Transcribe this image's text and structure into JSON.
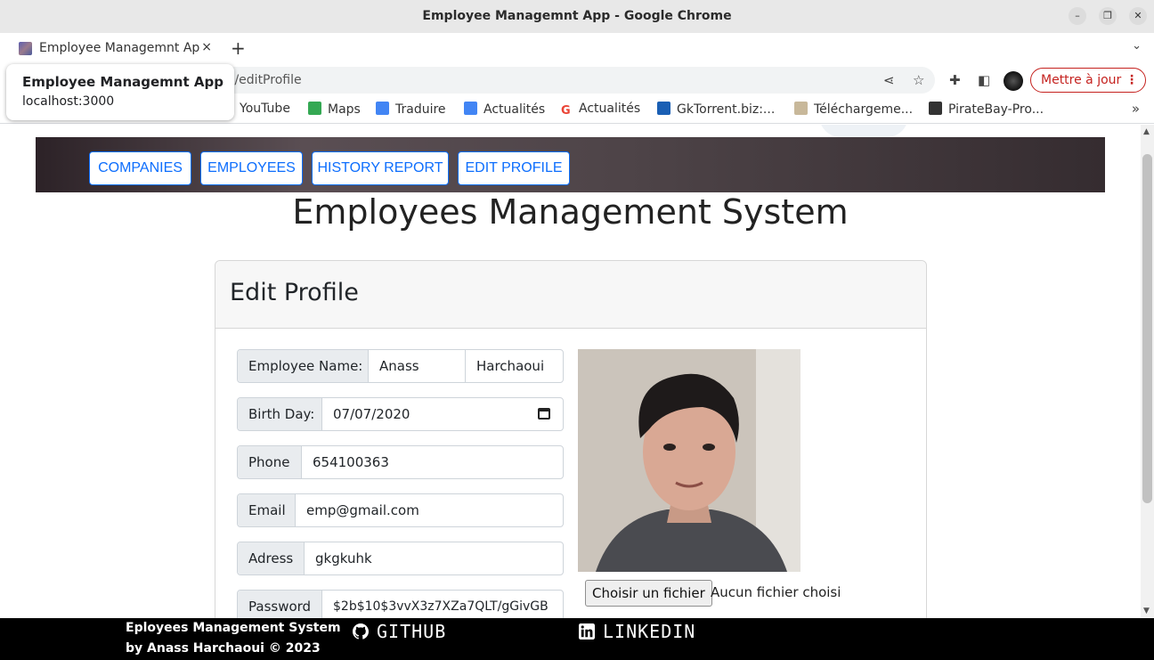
{
  "window": {
    "title": "Employee Managemnt App - Google Chrome"
  },
  "tab": {
    "title": "Employee Managemnt App",
    "close_icon": "×",
    "new_tab_icon": "+"
  },
  "address_bar": {
    "url_visible": ")/editProfile"
  },
  "update_button": {
    "label": "Mettre à jour"
  },
  "tooltip": {
    "title": "Employee Managemnt App",
    "host": "localhost:3000"
  },
  "bookmarks": [
    {
      "label": "YouTube",
      "icon": "youtube-icon",
      "color": "#ff0000"
    },
    {
      "label": "Maps",
      "icon": "maps-icon",
      "color": "#34a853"
    },
    {
      "label": "Traduire",
      "icon": "translate-icon",
      "color": "#4285f4"
    },
    {
      "label": "Actualités",
      "icon": "news-icon",
      "color": "#4285f4"
    },
    {
      "label": "Actualités",
      "icon": "google-icon",
      "color": "#ea4335"
    },
    {
      "label": "GkTorrent.biz:...",
      "icon": "download-icon",
      "color": "#1a5fb4"
    },
    {
      "label": "Téléchargeme...",
      "icon": "torrent-icon",
      "color": "#8a6d3b"
    },
    {
      "label": "PirateBay-Pro...",
      "icon": "ship-icon",
      "color": "#333333"
    }
  ],
  "nav": {
    "companies": "COMPANIES",
    "employees": "EMPLOYEES",
    "history": "HISTORY REPORT",
    "edit": "EDIT PROFILE"
  },
  "page": {
    "title": "Employees Management System"
  },
  "form": {
    "header": "Edit Profile",
    "name_label": "Employee Name:",
    "first_name": "Anass",
    "last_name": "Harchaoui",
    "birth_label": "Birth Day:",
    "birth_value": "07/07/2020",
    "phone_label": "Phone",
    "phone_value": "654100363",
    "email_label": "Email",
    "email_value": "emp@gmail.com",
    "address_label": "Adress",
    "address_value": "gkgkuhk",
    "password_label": "Password",
    "password_value": "$2b$10$3vvX3z7XZa7QLT/gGivGB",
    "file_button": "Choisir un fichier",
    "file_status": "Aucun fichier choisi"
  },
  "footer": {
    "line1": "Eployees Management System",
    "line2": "by Anass Harchaoui © 2023",
    "github": "GITHUB",
    "linkedin": "LINKEDIN"
  },
  "colors": {
    "primary": "#0d6efd",
    "navbar": "#4e4448",
    "footer": "#000000",
    "update": "#c5221f"
  }
}
